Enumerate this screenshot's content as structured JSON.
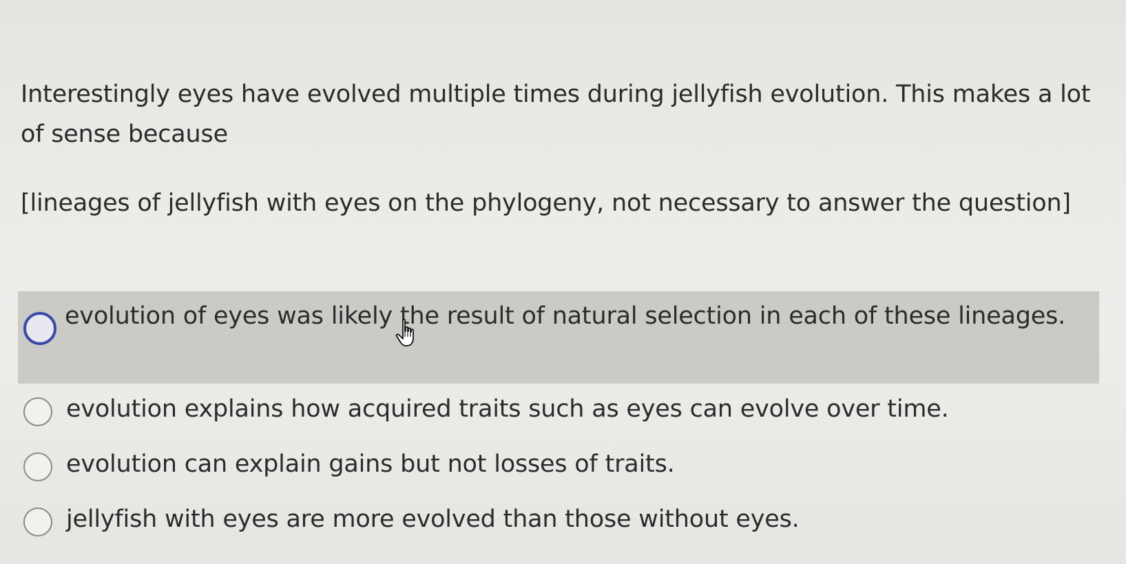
{
  "question": {
    "text": "Interestingly eyes have evolved multiple times during jellyfish evolution. This makes a lot of sense because",
    "note": "[lineages of jellyfish with eyes on the phylogeny, not necessary to answer the question]"
  },
  "options": [
    {
      "label": "evolution of eyes was likely the result of natural selection in each of these lineages."
    },
    {
      "label": "evolution explains how acquired traits such as eyes can evolve over time."
    },
    {
      "label": "evolution can explain gains but not losses of traits."
    },
    {
      "label": "jellyfish with eyes are more evolved than those without eyes."
    }
  ],
  "colors": {
    "selected_row_bg": "#cbcac7",
    "radio_focus": "#3a4aa6",
    "text": "#2b2b2b"
  },
  "icons": {
    "cursor": "hand-pointer-icon",
    "radio": "radio-button-icon"
  }
}
